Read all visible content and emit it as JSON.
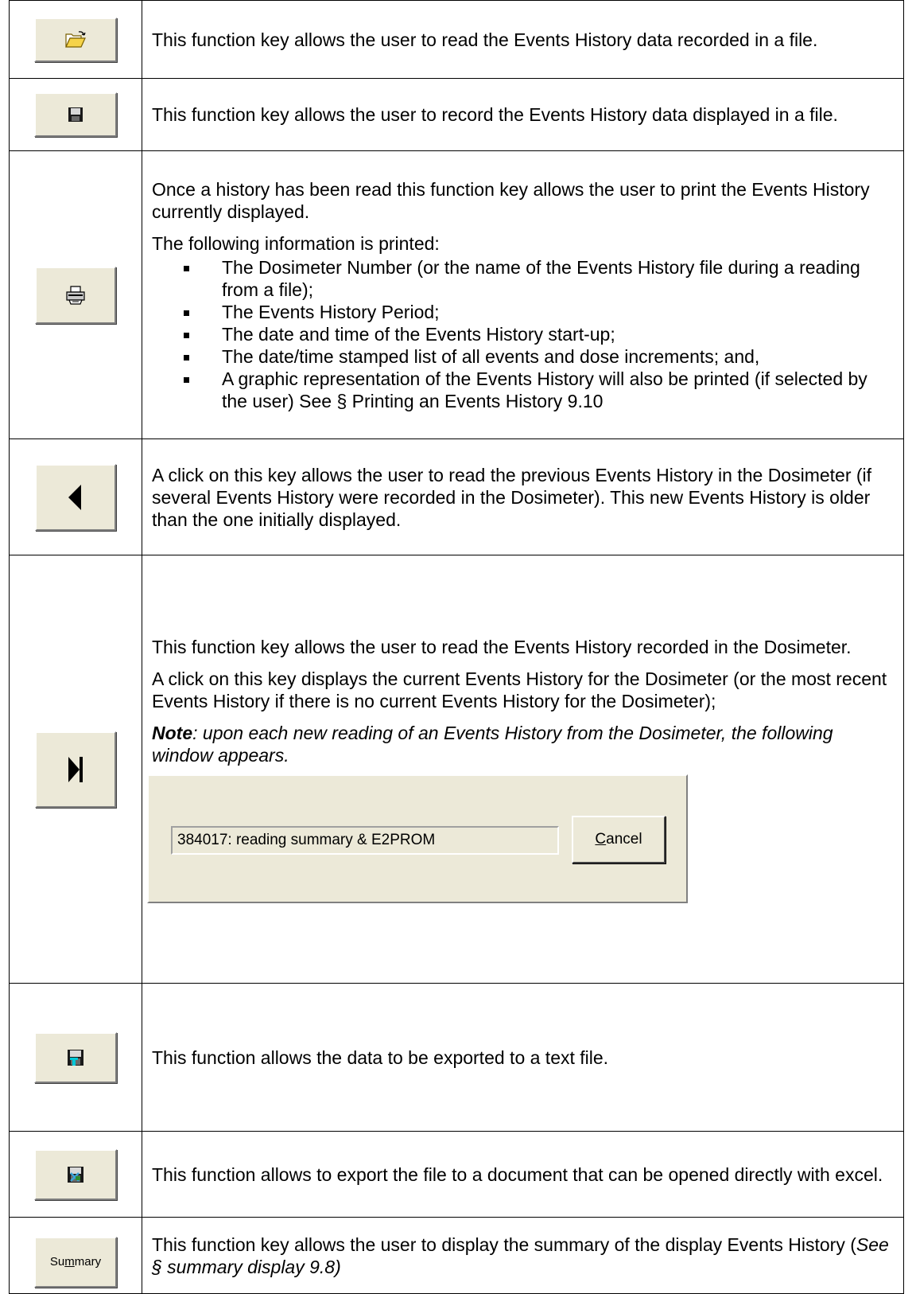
{
  "rows": [
    {
      "icon": "open-folder-icon",
      "text": "This function key allows the user to read the Events History data recorded in a file."
    },
    {
      "icon": "save-disk-icon",
      "text": "This function key allows the user to record the Events History data displayed in a file."
    },
    {
      "icon": "printer-icon",
      "intro": "Once a history has been read this function key allows the user to print the Events History currently displayed.",
      "list_title": "The following information is printed:",
      "bullets": [
        "The Dosimeter Number (or the name of the Events History file during a reading from a file);",
        "The Events History Period;",
        "The date and time of the Events History start-up;",
        "The date/time stamped list of all events and dose increments; and,",
        "A graphic representation of the Events History will also be printed (if selected by the user) See § Printing an Events History 9.10"
      ]
    },
    {
      "icon": "previous-triangle-icon",
      "text": "A click on this key allows the user to read the previous Events History in the Dosimeter (if several Events History were recorded in the Dosimeter). This new Events History is older than the one initially displayed."
    },
    {
      "icon": "skip-to-end-icon",
      "p1": "This function key allows the user to read the Events History recorded in the Dosimeter.",
      "p2": "A click on this key displays the current Events History for the Dosimeter (or the most recent Events History if there is no current Events History for the Dosimeter);",
      "note_label": "Note",
      "note_text": ": upon each new reading of an Events History from the Dosimeter, the following window appears.",
      "dialog": {
        "status": "384017: reading  summary & E2PROM",
        "cancel_first": "C",
        "cancel_rest": "ancel"
      }
    },
    {
      "icon": "export-text-icon",
      "text": "This function allows the data to be exported to a text file."
    },
    {
      "icon": "export-excel-icon",
      "text": "This function allows to export the file to a document that can be opened directly with excel."
    },
    {
      "button": {
        "pre": "Su",
        "ul": "m",
        "post": "mary"
      },
      "text_pre": "This function key allows the user to display the summary of the display Events History (",
      "text_ref": "See § summary display 9.8)"
    }
  ]
}
